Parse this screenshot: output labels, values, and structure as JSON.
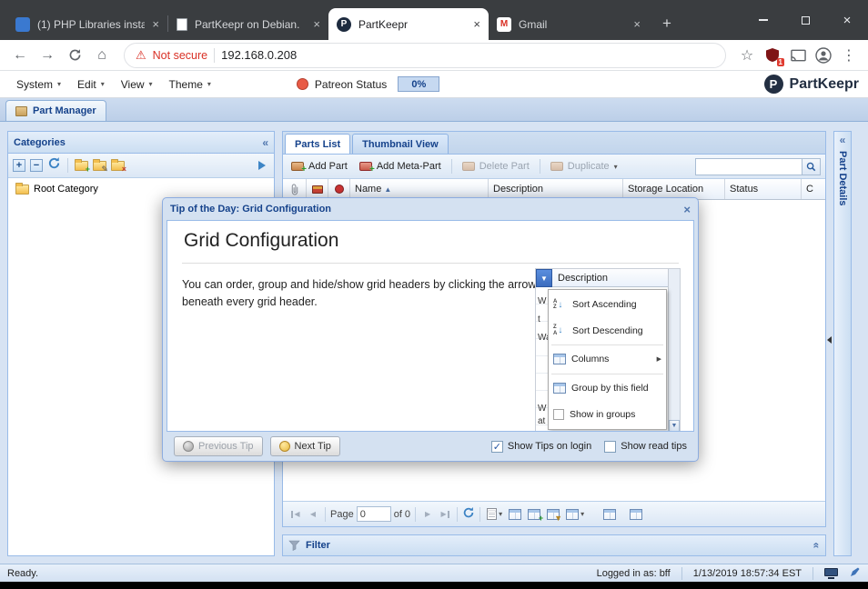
{
  "icons": {
    "close": "×",
    "plus": "+",
    "minus": "−",
    "back": "←",
    "forward": "→",
    "home": "⌂",
    "warning": "⚠",
    "star": "☆",
    "kebab": "⋮",
    "dropdown": "▾",
    "sort_asc": "▲",
    "collapse_left": "«",
    "submenu": "▶",
    "tri_left": "◀",
    "tri_right": "▶",
    "tri_down": "▼",
    "check": "✓",
    "down_arrow": "↓",
    "pencil": "✎",
    "letter_a": "A",
    "letter_z": "Z",
    "gmail_m": "M"
  },
  "browser": {
    "tabs": [
      {
        "label": "(1) PHP Libraries insta"
      },
      {
        "label": "PartKeepr on Debian."
      },
      {
        "label": "PartKeepr"
      },
      {
        "label": "Gmail"
      }
    ],
    "address": {
      "security": "Not secure",
      "url": "192.168.0.208"
    },
    "extension_badge": "1"
  },
  "menubar": {
    "items": [
      {
        "label": "System"
      },
      {
        "label": "Edit"
      },
      {
        "label": "View"
      },
      {
        "label": "Theme"
      }
    ],
    "patreon_label": "Patreon Status",
    "progress": "0%",
    "brand": "PartKeepr",
    "brand_initial": "P"
  },
  "workspace": {
    "tab": "Part Manager"
  },
  "categories": {
    "title": "Categories",
    "root_label": "Root Category"
  },
  "parts": {
    "tabs": [
      {
        "label": "Parts List"
      },
      {
        "label": "Thumbnail View"
      }
    ],
    "buttons": [
      {
        "label": "Add Part"
      },
      {
        "label": "Add Meta-Part"
      },
      {
        "label": "Delete Part"
      },
      {
        "label": "Duplicate"
      }
    ],
    "columns": [
      {
        "label": "Name"
      },
      {
        "label": "Description"
      },
      {
        "label": "Storage Location"
      },
      {
        "label": "Status"
      },
      {
        "label": "C"
      }
    ],
    "paging": {
      "page_label": "Page",
      "page_value": "0",
      "of_label": "of 0"
    }
  },
  "filter": {
    "title": "Filter"
  },
  "part_details": {
    "title": "Part Details"
  },
  "dialog": {
    "title": "Tip of the Day: Grid Configuration",
    "heading": "Grid Configuration",
    "body_text": "You can order, group and hide/show grid headers by clicking the arrow beneath every grid header.",
    "grid_column": "Description",
    "menu_items": [
      {
        "label": "Sort Ascending"
      },
      {
        "label": "Sort Descending"
      },
      {
        "label": "Columns"
      },
      {
        "label": "Group by this field"
      },
      {
        "label": "Show in groups"
      }
    ],
    "fragments": [
      "W",
      "t",
      "Wa",
      "W",
      "at"
    ],
    "previous_label": "Previous Tip",
    "next_label": "Next Tip",
    "show_tips_label": "Show Tips on login",
    "show_read_label": "Show read tips"
  },
  "statusbar": {
    "ready": "Ready.",
    "logged_in": "Logged in as: bff",
    "timestamp": "1/13/2019 18:57:34 EST"
  }
}
